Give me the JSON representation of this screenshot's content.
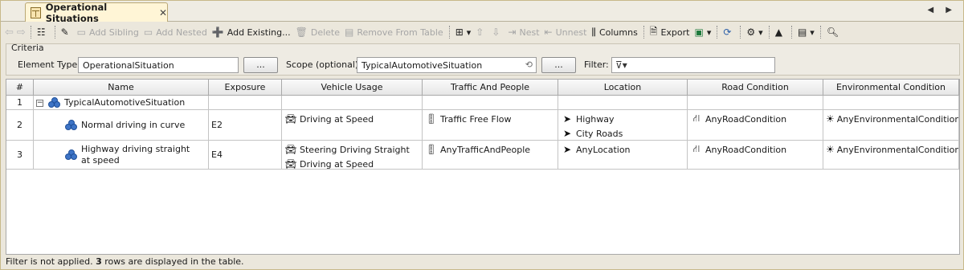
{
  "tab": {
    "title": "Operational Situations",
    "close": "✕",
    "nav": "◀ ▶"
  },
  "toolbar": {
    "add_sibling": "Add Sibling",
    "add_nested": "Add Nested",
    "add_existing": "Add Existing...",
    "delete": "Delete",
    "remove_from_table": "Remove From Table",
    "nest": "Nest",
    "unnest": "Unnest",
    "columns": "Columns",
    "export": "Export"
  },
  "criteria": {
    "title": "Criteria",
    "element_type_label": "Element Type:",
    "element_type_value": "OperationalSituation",
    "browse_label": "...",
    "scope_label": "Scope (optional):",
    "scope_value": "TypicalAutomotiveSituation",
    "filter_label": "Filter:",
    "filter_value": ""
  },
  "table": {
    "columns": [
      "#",
      "Name",
      "Exposure",
      "Vehicle Usage",
      "Traffic And People",
      "Location",
      "Road Condition",
      "Environmental Condition"
    ],
    "rows": [
      {
        "num": "1",
        "name": "TypicalAutomotiveSituation",
        "exposure": "",
        "vehicle_usage": [],
        "traffic": [],
        "location": [],
        "road": [],
        "environment": []
      },
      {
        "num": "2",
        "name": "Normal driving in curve",
        "exposure": "E2",
        "vehicle_usage": [
          "Driving at Speed"
        ],
        "traffic": [
          "Traffic Free Flow"
        ],
        "location": [
          "Highway",
          "City Roads"
        ],
        "road": [
          "AnyRoadCondition"
        ],
        "environment": [
          "AnyEnvironmentalCondition"
        ]
      },
      {
        "num": "3",
        "name": "Highway driving straight at speed",
        "exposure": "E4",
        "vehicle_usage": [
          "Steering Driving Straight",
          "Driving at Speed"
        ],
        "traffic": [
          "AnyTrafficAndPeople"
        ],
        "location": [
          "AnyLocation"
        ],
        "road": [
          "AnyRoadCondition"
        ],
        "environment": [
          "AnyEnvironmentalCondition"
        ]
      }
    ]
  },
  "status": {
    "prefix": "Filter is not applied. ",
    "count": "3",
    "suffix": " rows are displayed in the table."
  },
  "icons": {
    "vehicle": "car-icon",
    "traffic": "traffic-light-icon",
    "location": "location-arrow-icon",
    "road": "road-icon",
    "environment": "weather-icon"
  }
}
